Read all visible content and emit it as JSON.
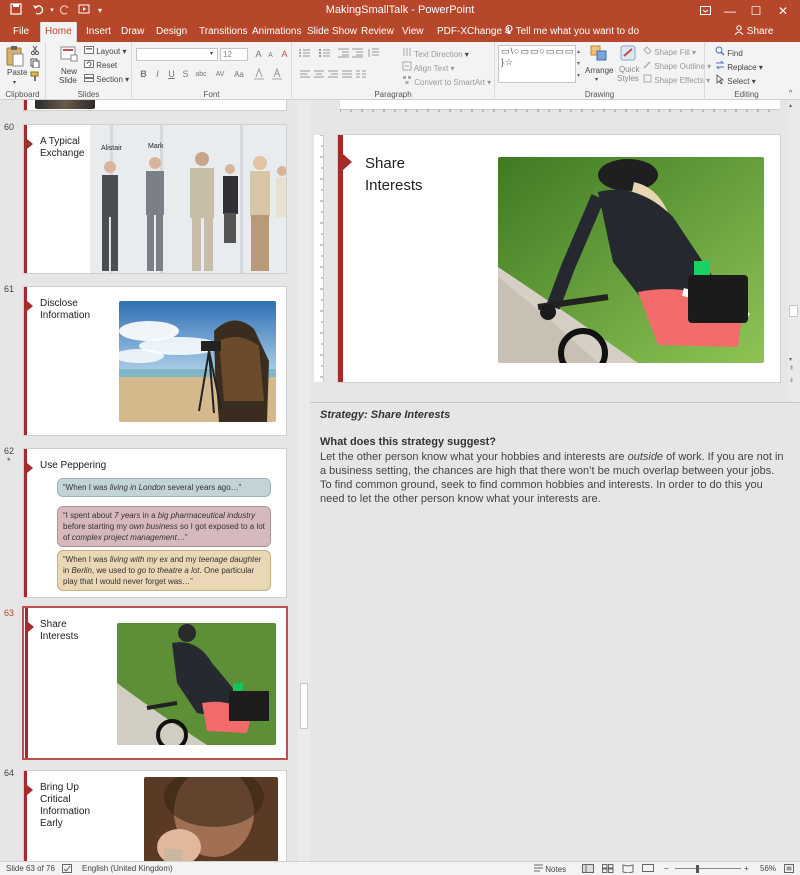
{
  "window": {
    "title": "MakingSmallTalk  -  PowerPoint"
  },
  "quick_access": {
    "save_icon": "save-icon",
    "undo_icon": "undo-icon",
    "redo_icon": "redo-icon",
    "start_icon": "start-from-beginning-icon",
    "customize_icon": "customize-qat-icon"
  },
  "window_controls": {
    "restore_ribbon_icon": "ribbon-display-icon",
    "minimize": "—",
    "maximize": "☐",
    "close": "✕"
  },
  "tabs": [
    "File",
    "Home",
    "Insert",
    "Draw",
    "Design",
    "Transitions",
    "Animations",
    "Slide Show",
    "Review",
    "View",
    "PDF-XChange 4"
  ],
  "active_tab": "Home",
  "tell_me": "Tell me what you want to do",
  "share": "Share",
  "ribbon": {
    "clipboard": {
      "label": "Clipboard",
      "paste": "Paste"
    },
    "slides": {
      "label": "Slides",
      "new_slide": "New",
      "new_slide2": "Slide",
      "layout": "Layout",
      "reset": "Reset",
      "section": "Section"
    },
    "font": {
      "label": "Font",
      "size": "12",
      "bold": "B",
      "italic": "I",
      "underline": "U",
      "strike": "S",
      "shadow": "abc",
      "spacing": "AV",
      "case": "Aa",
      "grow": "A",
      "shrink": "A",
      "clear": "A"
    },
    "paragraph": {
      "label": "Paragraph",
      "text_direction": "Text Direction",
      "align_text": "Align Text",
      "convert_smartart": "Convert to SmartArt"
    },
    "drawing": {
      "label": "Drawing",
      "arrange": "Arrange",
      "quick_styles": "Quick",
      "quick_styles2": "Styles",
      "shape_fill": "Shape Fill",
      "shape_outline": "Shape Outline",
      "shape_effects": "Shape Effects",
      "shapes_glyphs": "▭\\○▭▭○▭▭▭△⌐⌐⇨⇩⇧◇\\⌒⌒{ }☆"
    },
    "editing": {
      "label": "Editing",
      "find": "Find",
      "replace": "Replace",
      "select": "Select"
    }
  },
  "slides": [
    {
      "number": "60",
      "title": "A Typical Exchange",
      "labels": [
        "Alistair",
        "Mark"
      ]
    },
    {
      "number": "61",
      "title": "Disclose Information"
    },
    {
      "number": "62",
      "star": "*",
      "title": "Use Peppering",
      "bubbles": [
        {
          "parts": [
            {
              "t": "“When I was "
            },
            {
              "i": "living in London"
            },
            {
              "t": " several years ago…”"
            }
          ]
        },
        {
          "parts": [
            {
              "t": "“I spent about "
            },
            {
              "i": "7 years"
            },
            {
              "t": " in a "
            },
            {
              "i": "big pharmaceutical industry"
            },
            {
              "t": " before starting my "
            },
            {
              "i": "own business"
            },
            {
              "t": " so I got exposed to a lot of "
            },
            {
              "i": "complex project management"
            },
            {
              "t": "…”"
            }
          ]
        },
        {
          "parts": [
            {
              "t": "“When I was "
            },
            {
              "i": "living with my ex"
            },
            {
              "t": " and my "
            },
            {
              "i": "teenage daughter"
            },
            {
              "t": " in "
            },
            {
              "i": "Berlin"
            },
            {
              "t": ", we used to "
            },
            {
              "i": "go to theatre a lot"
            },
            {
              "t": ". One particular play that I would never forget was…”"
            }
          ]
        }
      ]
    },
    {
      "number": "63",
      "title": "Share Interests",
      "active": true
    },
    {
      "number": "64",
      "title": "Bring Up Critical Information Early"
    }
  ],
  "current_slide": {
    "title": "Share Interests"
  },
  "notes": {
    "strategy": "Strategy: Share Interests",
    "question": "What does this strategy suggest?",
    "body_parts": [
      {
        "t": "Let the other person know what your hobbies and interests are "
      },
      {
        "i": "outside"
      },
      {
        "t": " of work. If you are not in a business setting, the chances are high that there won’t be much overlap between your jobs. To find common ground, seek to find common hobbies and interests. In order to do this you need to let the other person know what your interests are."
      }
    ]
  },
  "status": {
    "slide_info": "Slide 63 of 76",
    "language": "English (United Kingdom)",
    "notes": "Notes",
    "zoom": "56%"
  },
  "colors": {
    "accent": "#b7472a",
    "slide_bar": "#a52a2a"
  }
}
